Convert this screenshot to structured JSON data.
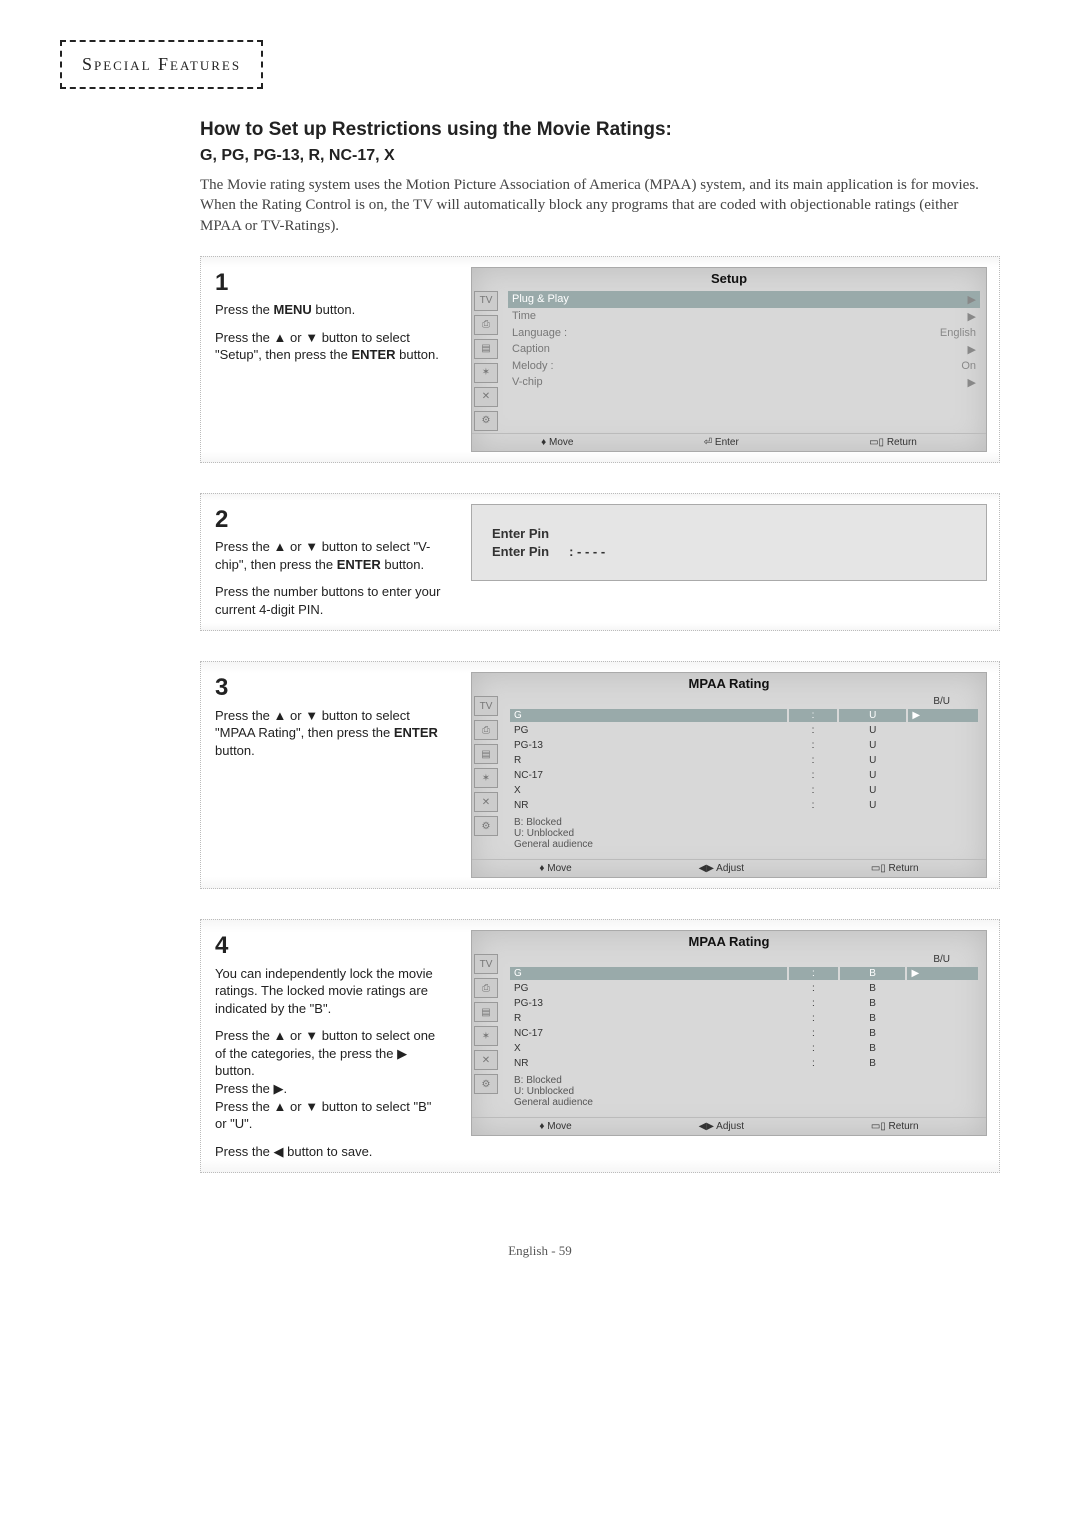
{
  "header": "Special Features",
  "title": "How to Set up Restrictions using the Movie Ratings:",
  "subtitle": "G, PG, PG-13, R, NC-17, X",
  "intro": "The Movie rating system uses the Motion Picture Association of America (MPAA) system, and its main application is for movies.\nWhen the Rating Control is on, the TV will automatically block any programs that are coded with objectionable ratings (either MPAA or TV-Ratings).",
  "steps": {
    "s1": {
      "num": "1",
      "lines": [
        "Press the <b>MENU</b> button.",
        "",
        "Press the <tri>▲</tri> or <tri>▼</tri> button to select \"Setup\", then press the <b>ENTER</b> button."
      ]
    },
    "s2": {
      "num": "2",
      "lines": [
        "Press the <tri>▲</tri> or <tri>▼</tri> button to select \"V-chip\", then press the <b>ENTER</b> button.",
        "",
        "Press the number buttons to enter your current 4-digit PIN."
      ]
    },
    "s3": {
      "num": "3",
      "lines": [
        "Press the <tri>▲</tri> or <tri>▼</tri> button to select \"MPAA Rating\", then press the <b>ENTER</b> button."
      ]
    },
    "s4": {
      "num": "4",
      "lines": [
        "You can independently lock the movie ratings. The locked movie ratings are indicated by the \"B\".",
        "",
        "Press the <tri>▲</tri> or <tri>▼</tri> button to select one of the categories, the press the <tri>▶</tri> button.",
        "Press the <tri>▶</tri>.",
        "Press the <tri>▲</tri> or <tri>▼</tri> button to select \"B\" or \"U\".",
        "",
        "Press the <tri>◀</tri> button to save."
      ]
    }
  },
  "osd1": {
    "title": "Setup",
    "items": [
      {
        "label": "Plug & Play",
        "val": "",
        "sel": true,
        "arrow": "▶"
      },
      {
        "label": "Time",
        "val": "",
        "arrow": "▶"
      },
      {
        "label": "Language :",
        "val": "English"
      },
      {
        "label": "Caption",
        "val": "",
        "arrow": "▶"
      },
      {
        "label": "Melody   :",
        "val": "On"
      },
      {
        "label": "V-chip",
        "val": "",
        "arrow": "▶"
      }
    ],
    "footer": [
      "♦ Move",
      "⏎ Enter",
      "▭▯ Return"
    ]
  },
  "osd2": {
    "title1": "Enter Pin",
    "title2": "Enter Pin",
    "dots": ": - - - -"
  },
  "osd3": {
    "title": "MPAA Rating",
    "col": "B/U",
    "rows": [
      {
        "r": "G",
        "v": "U",
        "sel": true
      },
      {
        "r": "PG",
        "v": "U"
      },
      {
        "r": "PG-13",
        "v": "U"
      },
      {
        "r": "R",
        "v": "U"
      },
      {
        "r": "NC-17",
        "v": "U"
      },
      {
        "r": "X",
        "v": "U"
      },
      {
        "r": "NR",
        "v": "U"
      }
    ],
    "legend": [
      "B: Blocked",
      "U: Unblocked",
      "General audience"
    ],
    "footer": [
      "♦ Move",
      "◀▶ Adjust",
      "▭▯ Return"
    ]
  },
  "osd4": {
    "title": "MPAA Rating",
    "col": "B/U",
    "rows": [
      {
        "r": "G",
        "v": "B",
        "sel": true
      },
      {
        "r": "PG",
        "v": "B"
      },
      {
        "r": "PG-13",
        "v": "B"
      },
      {
        "r": "R",
        "v": "B"
      },
      {
        "r": "NC-17",
        "v": "B"
      },
      {
        "r": "X",
        "v": "B"
      },
      {
        "r": "NR",
        "v": "B"
      }
    ],
    "legend": [
      "B: Blocked",
      "U: Unblocked",
      "General audience"
    ],
    "footer": [
      "♦ Move",
      "◀▶ Adjust",
      "▭▯ Return"
    ]
  },
  "tabs": [
    "TV",
    "⎙",
    "▤",
    "✶",
    "✕",
    "⚙"
  ],
  "footer": "English - 59"
}
